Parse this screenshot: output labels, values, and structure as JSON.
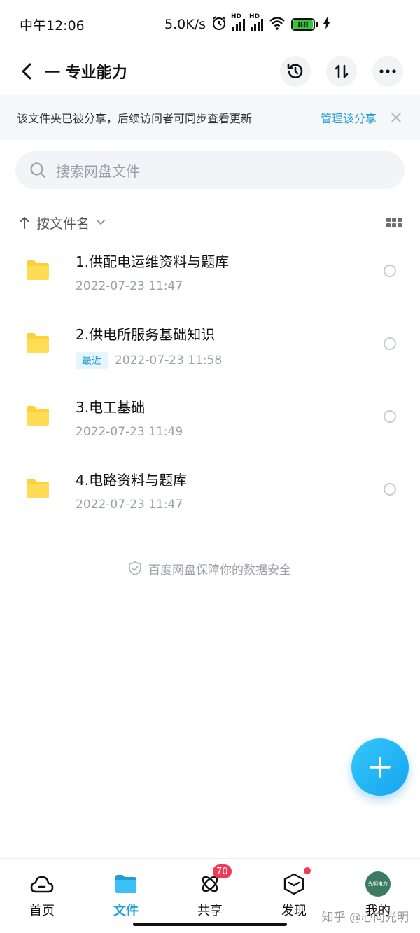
{
  "status_bar": {
    "time": "中午12:06",
    "speed": "5.0K/s",
    "hd1": "HD",
    "hd2": "HD",
    "battery": "88"
  },
  "header": {
    "title": "一 专业能力"
  },
  "share_notice": {
    "text": "该文件夹已被分享，后续访问者可同步查看更新",
    "manage_label": "管理该分享"
  },
  "search": {
    "placeholder": "搜索网盘文件"
  },
  "sort": {
    "label": "按文件名"
  },
  "files": [
    {
      "name": "1.供配电运维资料与题库",
      "date": "2022-07-23  11:47",
      "badge": ""
    },
    {
      "name": "2.供电所服务基础知识",
      "date": "2022-07-23  11:58",
      "badge": "最近"
    },
    {
      "name": "3.电工基础",
      "date": "2022-07-23  11:49",
      "badge": ""
    },
    {
      "name": "4.电路资料与题库",
      "date": "2022-07-23  11:47",
      "badge": ""
    }
  ],
  "safety_note": "百度网盘保障你的数据安全",
  "bottom_nav": {
    "items": [
      {
        "label": "首页",
        "icon": "cloud-icon"
      },
      {
        "label": "文件",
        "icon": "folder-icon"
      },
      {
        "label": "共享",
        "icon": "share-atom-icon",
        "badge": "70"
      },
      {
        "label": "发现",
        "icon": "discover-box-icon"
      },
      {
        "label": "我的",
        "icon": "avatar"
      }
    ]
  },
  "avatar_text": "光明电力",
  "watermark": "知乎 @心向光明",
  "colors": {
    "accent": "#1f9ed8",
    "folder": "#fbd23b",
    "badge": "#ef3c54",
    "battery": "#37c33c"
  }
}
